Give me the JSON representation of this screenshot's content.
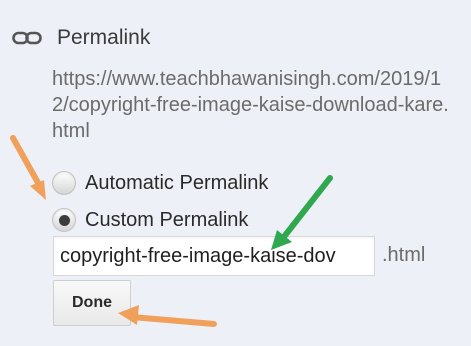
{
  "header": {
    "title": "Permalink",
    "icon": "link-icon"
  },
  "url_preview": "https://www.teachbhawanisingh.com/2019/12/copyright-free-image-kaise-download-kare.html",
  "options": {
    "automatic": {
      "label": "Automatic Permalink",
      "selected": false
    },
    "custom": {
      "label": "Custom Permalink",
      "selected": true
    }
  },
  "slug_field": {
    "value": "copyright-free-image-kaise-dov",
    "suffix": ".html"
  },
  "done_button": {
    "label": "Done"
  },
  "colors": {
    "annotation_orange": "#f0a05a",
    "annotation_green": "#2fa84f",
    "background": "#eef0f7"
  }
}
